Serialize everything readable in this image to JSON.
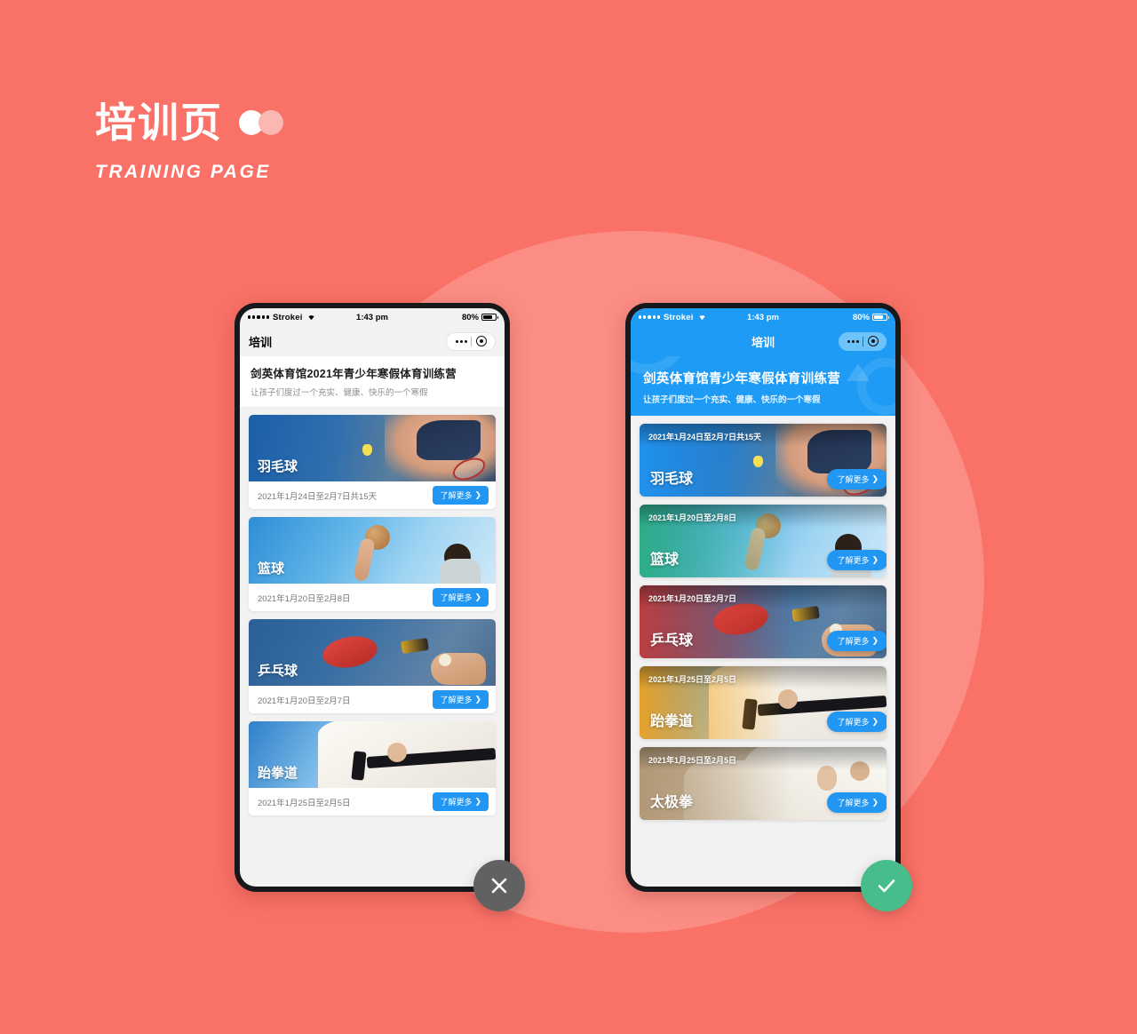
{
  "heading": {
    "title": "培训页",
    "subtitle": "TRAINING PAGE",
    "dot_primary_color": "#ffffff",
    "dot_secondary_color": "#fbb7b1"
  },
  "background": {
    "base_color": "#f97167",
    "circle_color": "#fb8d84"
  },
  "status_bar": {
    "carrier": "Strokei",
    "time": "1:43 pm",
    "battery": "80%"
  },
  "left_phone": {
    "nav": {
      "title": "培训",
      "menu_icon": "more-dots-icon",
      "target_icon": "target-icon"
    },
    "banner": {
      "title": "剑英体育馆2021年青少年寒假体育训练营",
      "subtitle": "让孩子们度过一个充实、健康、快乐的一个寒假"
    },
    "cards": [
      {
        "name": "羽毛球",
        "date": "2021年1月24日至2月7日共15天",
        "button": "了解更多"
      },
      {
        "name": "篮球",
        "date": "2021年1月20日至2月8日",
        "button": "了解更多"
      },
      {
        "name": "乒乓球",
        "date": "2021年1月20日至2月7日",
        "button": "了解更多"
      },
      {
        "name": "跆拳道",
        "date": "2021年1月25日至2月5日",
        "button": "了解更多"
      }
    ]
  },
  "right_phone": {
    "nav": {
      "title": "培训",
      "menu_icon": "more-dots-icon",
      "target_icon": "target-icon"
    },
    "banner": {
      "title": "剑英体育馆青少年寒假体育训练营",
      "subtitle": "让孩子们度过一个充实、健康、快乐的一个寒假",
      "background_color": "#1e9cf5"
    },
    "cards": [
      {
        "name": "羽毛球",
        "date": "2021年1月24日至2月7日共15天",
        "button": "了解更多"
      },
      {
        "name": "篮球",
        "date": "2021年1月20日至2月8日",
        "button": "了解更多"
      },
      {
        "name": "乒乓球",
        "date": "2021年1月20日至2月7日",
        "button": "了解更多"
      },
      {
        "name": "跆拳道",
        "date": "2021年1月25日至2月5日",
        "button": "了解更多"
      },
      {
        "name": "太极拳",
        "date": "2021年1月25日至2月5日",
        "button": "了解更多"
      }
    ]
  },
  "fabs": {
    "reject": {
      "icon": "close-icon",
      "color": "#616161"
    },
    "accept": {
      "icon": "check-icon",
      "color": "#47bd8b"
    }
  },
  "chevron": "❯"
}
